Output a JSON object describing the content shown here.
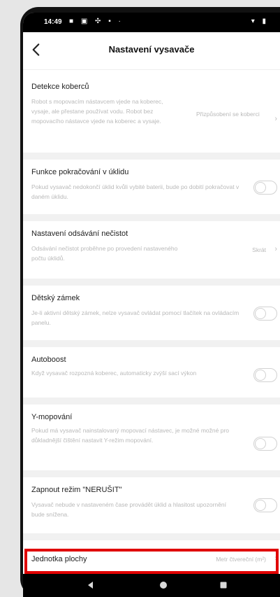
{
  "status_bar": {
    "time": "14:49",
    "icons_left": "■ ▣ ✣ ▪ ·",
    "icons_right": "▾ ▮"
  },
  "app_bar": {
    "back_icon": "chevron-left-icon",
    "title": "Nastavení vysavače"
  },
  "settings": [
    {
      "title": "Detekce koberců",
      "description": "Robot s mopovacím nástavcem vjede na koberec, vysaje, ale přestane používat vodu. Robot bez mopovacího nástavce vjede na koberec a vysaje.",
      "value": "Přizpůsobení se koberci",
      "control": "chevron"
    },
    {
      "title": "Funkce pokračování v úklidu",
      "description": "Pokud vysavač nedokončí úklid kvůli vybité baterii, bude po dobití pokračovat v daném úklidu.",
      "control": "toggle",
      "on": false
    },
    {
      "title": "Nastavení odsávání nečistot",
      "description": "Odsávání nečistot proběhne po provedení nastaveného počtu úklidů.",
      "value": "Skrát",
      "control": "chevron"
    },
    {
      "title": "Dětský zámek",
      "description": "Je-li aktivní dětský zámek, nelze vysavač ovládat pomocí tlačítek na ovládacím panelu.",
      "control": "toggle",
      "on": false
    },
    {
      "title": "Autoboost",
      "description": "Když vysavač rozpozná koberec, automaticky zvýší sací výkon",
      "control": "toggle",
      "on": false
    },
    {
      "title": "Y-mopování",
      "description": "Pokud má vysavač nainstalovaný mopovací nástavec, je možné možné pro důkladnější čištění nastavit Y-režim mopování.",
      "control": "toggle",
      "on": false
    },
    {
      "title": "Zapnout režim \"NERUŠIT\"",
      "description": "Vysavač nebude v nastaveném čase provádět úklid a hlasitost upozornění bude snížena.",
      "control": "toggle",
      "on": false
    },
    {
      "title": "Jednotka plochy",
      "value": "Metr čtvereční (m²)",
      "control": "chevron"
    }
  ],
  "highlight_color": "#e00000",
  "nav_bar": {
    "back": "nav-back-icon",
    "home": "nav-home-icon",
    "recent": "nav-recent-icon"
  }
}
